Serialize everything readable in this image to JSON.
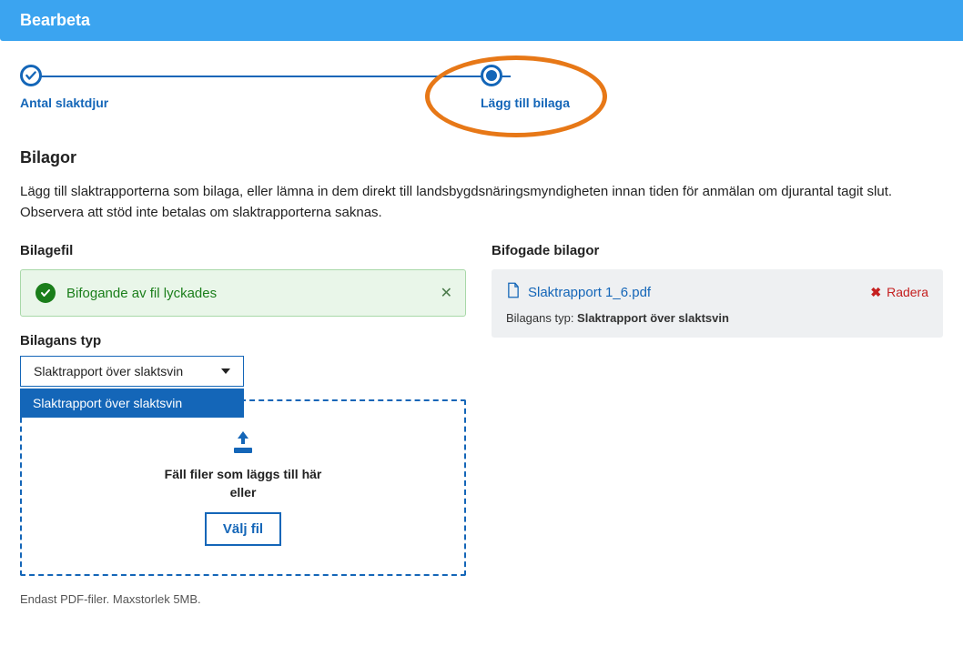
{
  "header": {
    "title": "Bearbeta"
  },
  "stepper": {
    "steps": [
      {
        "label": "Antal slaktdjur"
      },
      {
        "label": "Lägg till bilaga"
      }
    ]
  },
  "section": {
    "title": "Bilagor",
    "intro": "Lägg till slaktrapporterna som bilaga, eller lämna in dem direkt till landsbygdsnäringsmyndigheten innan tiden för anmälan om djurantal tagit slut. Observera att stöd inte betalas om slaktrapporterna saknas."
  },
  "left": {
    "header": "Bilagefil",
    "alert": {
      "message": "Bifogande av fil lyckades"
    },
    "typeLabel": "Bilagans typ",
    "select": {
      "value": "Slaktrapport över slaktsvin",
      "option": "Slaktrapport över slaktsvin"
    },
    "dropzone": {
      "text_line1": "Fäll filer som läggs till här",
      "text_line2": "eller",
      "pick": "Välj fil"
    },
    "hint": "Endast PDF-filer. Maxstorlek 5MB."
  },
  "right": {
    "header": "Bifogade bilagor",
    "attachment": {
      "filename": "Slaktrapport 1_6.pdf",
      "delete": "Radera",
      "typeLabel": "Bilagans typ: ",
      "typeValue": "Slaktrapport över slaktsvin"
    }
  }
}
